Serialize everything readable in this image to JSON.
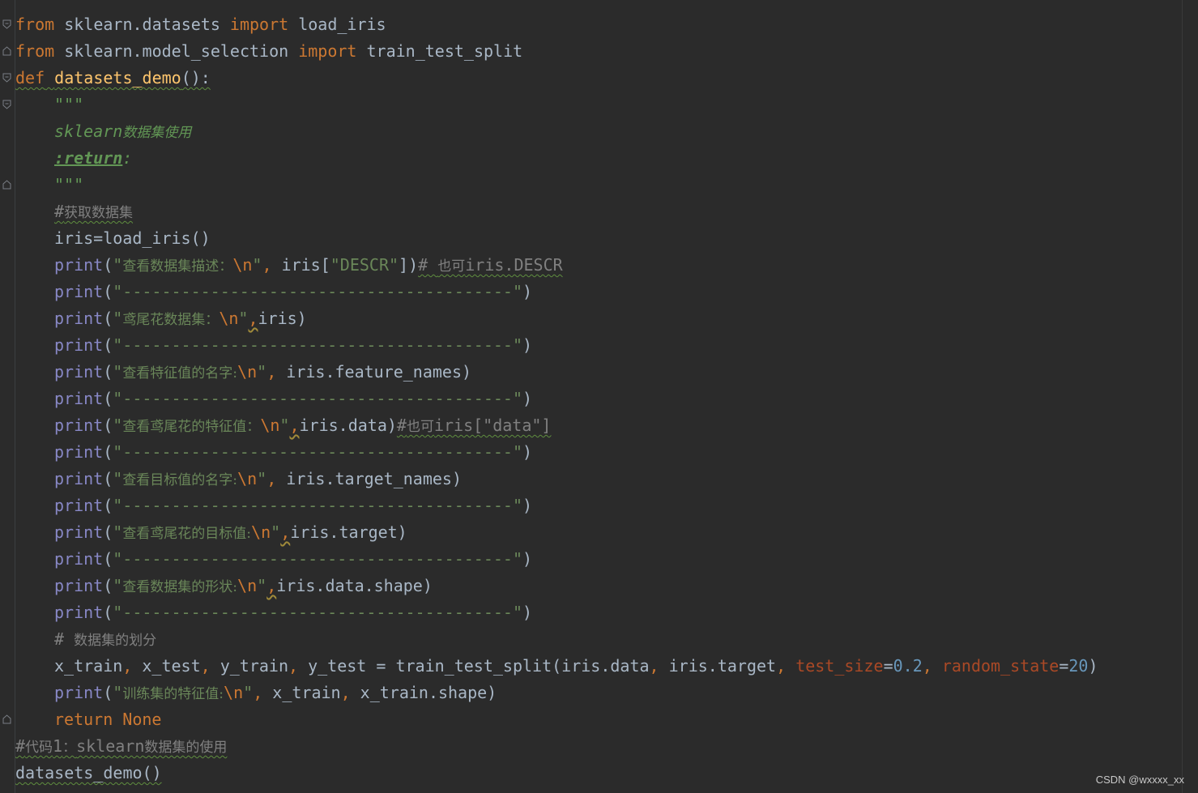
{
  "lines": [
    {
      "tokens": [
        [
          "kw",
          "from"
        ],
        [
          "plain",
          " sklearn.datasets "
        ],
        [
          "kw",
          "import"
        ],
        [
          "plain",
          " load_iris"
        ]
      ]
    },
    {
      "tokens": [
        [
          "kw",
          "from"
        ],
        [
          "plain",
          " sklearn.model_selection "
        ],
        [
          "kw",
          "import"
        ],
        [
          "plain",
          " train_test_split"
        ]
      ]
    },
    {
      "tokens": [
        [
          "kw",
          "def"
        ],
        [
          "plain",
          " "
        ],
        [
          "fn",
          "datasets_demo"
        ],
        [
          "plain",
          "():"
        ]
      ],
      "underline": true
    },
    {
      "indent": true,
      "tokens": [
        [
          "doc",
          "\"\"\""
        ]
      ]
    },
    {
      "indent": true,
      "tokens": [
        [
          "doc",
          "sklearn"
        ],
        [
          "doc cjk",
          "数据集使用"
        ]
      ]
    },
    {
      "indent": true,
      "tokens": [
        [
          "doctag",
          ":return"
        ],
        [
          "doc",
          ":"
        ]
      ]
    },
    {
      "indent": true,
      "tokens": [
        [
          "doc",
          "\"\"\""
        ]
      ]
    },
    {
      "indent": true,
      "tokens": [
        [
          "cm warn",
          "#"
        ],
        [
          "cm cjk warn",
          "获取数据集"
        ]
      ]
    },
    {
      "indent": true,
      "tokens": [
        [
          "plain",
          "iris=load_iris()"
        ]
      ]
    },
    {
      "indent": true,
      "tokens": [
        [
          "builtin",
          "print"
        ],
        [
          "plain",
          "("
        ],
        [
          "str",
          "\""
        ],
        [
          "str cjk",
          "查看数据集描述："
        ],
        [
          "esc",
          "\\n"
        ],
        [
          "str",
          "\""
        ],
        [
          "esc",
          ","
        ],
        [
          "plain",
          " iris["
        ],
        [
          "str",
          "\"DESCR\""
        ],
        [
          "plain",
          "])"
        ],
        [
          "cm warn",
          "# "
        ],
        [
          "cm cjk warn",
          "也可"
        ],
        [
          "cm warn",
          "iris.DESCR"
        ]
      ]
    },
    {
      "indent": true,
      "tokens": [
        [
          "builtin",
          "print"
        ],
        [
          "plain",
          "("
        ],
        [
          "str",
          "\"----------------------------------------\""
        ],
        [
          "plain",
          ")"
        ]
      ]
    },
    {
      "indent": true,
      "tokens": [
        [
          "builtin",
          "print"
        ],
        [
          "plain",
          "("
        ],
        [
          "str",
          "\""
        ],
        [
          "str cjk",
          "鸢尾花数据集："
        ],
        [
          "esc",
          "\\n"
        ],
        [
          "str",
          "\""
        ],
        [
          "esc weak",
          ","
        ],
        [
          "plain",
          "iris)"
        ]
      ]
    },
    {
      "indent": true,
      "tokens": [
        [
          "builtin",
          "print"
        ],
        [
          "plain",
          "("
        ],
        [
          "str",
          "\"----------------------------------------\""
        ],
        [
          "plain",
          ")"
        ]
      ]
    },
    {
      "indent": true,
      "tokens": [
        [
          "builtin",
          "print"
        ],
        [
          "plain",
          "("
        ],
        [
          "str",
          "\""
        ],
        [
          "str cjk",
          "查看特征值的名字:"
        ],
        [
          "esc",
          "\\n"
        ],
        [
          "str",
          "\""
        ],
        [
          "esc",
          ","
        ],
        [
          "plain",
          " iris.feature_names)"
        ]
      ]
    },
    {
      "indent": true,
      "tokens": [
        [
          "builtin",
          "print"
        ],
        [
          "plain",
          "("
        ],
        [
          "str",
          "\"----------------------------------------\""
        ],
        [
          "plain",
          ")"
        ]
      ]
    },
    {
      "indent": true,
      "tokens": [
        [
          "builtin",
          "print"
        ],
        [
          "plain",
          "("
        ],
        [
          "str",
          "\""
        ],
        [
          "str cjk",
          "查看鸢尾花的特征值："
        ],
        [
          "esc",
          "\\n"
        ],
        [
          "str",
          "\""
        ],
        [
          "esc weak",
          ","
        ],
        [
          "plain",
          "iris.data)"
        ],
        [
          "cm warn",
          "#"
        ],
        [
          "cm cjk warn",
          "也可"
        ],
        [
          "cm warn",
          "iris[\"data\"]"
        ]
      ]
    },
    {
      "indent": true,
      "tokens": [
        [
          "builtin",
          "print"
        ],
        [
          "plain",
          "("
        ],
        [
          "str",
          "\"----------------------------------------\""
        ],
        [
          "plain",
          ")"
        ]
      ]
    },
    {
      "indent": true,
      "tokens": [
        [
          "builtin",
          "print"
        ],
        [
          "plain",
          "("
        ],
        [
          "str",
          "\""
        ],
        [
          "str cjk",
          "查看目标值的名字:"
        ],
        [
          "esc",
          "\\n"
        ],
        [
          "str",
          "\""
        ],
        [
          "esc",
          ","
        ],
        [
          "plain",
          " iris.target_names)"
        ]
      ]
    },
    {
      "indent": true,
      "tokens": [
        [
          "builtin",
          "print"
        ],
        [
          "plain",
          "("
        ],
        [
          "str",
          "\"----------------------------------------\""
        ],
        [
          "plain",
          ")"
        ]
      ]
    },
    {
      "indent": true,
      "tokens": [
        [
          "builtin",
          "print"
        ],
        [
          "plain",
          "("
        ],
        [
          "str",
          "\""
        ],
        [
          "str cjk",
          "查看鸢尾花的目标值:"
        ],
        [
          "esc",
          "\\n"
        ],
        [
          "str",
          "\""
        ],
        [
          "esc weak",
          ","
        ],
        [
          "plain",
          "iris.target)"
        ]
      ]
    },
    {
      "indent": true,
      "tokens": [
        [
          "builtin",
          "print"
        ],
        [
          "plain",
          "("
        ],
        [
          "str",
          "\"----------------------------------------\""
        ],
        [
          "plain",
          ")"
        ]
      ]
    },
    {
      "indent": true,
      "tokens": [
        [
          "builtin",
          "print"
        ],
        [
          "plain",
          "("
        ],
        [
          "str",
          "\""
        ],
        [
          "str cjk",
          "查看数据集的形状:"
        ],
        [
          "esc",
          "\\n"
        ],
        [
          "str",
          "\""
        ],
        [
          "esc weak",
          ","
        ],
        [
          "plain",
          "iris.data.shape)"
        ]
      ]
    },
    {
      "indent": true,
      "tokens": [
        [
          "builtin",
          "print"
        ],
        [
          "plain",
          "("
        ],
        [
          "str",
          "\"----------------------------------------\""
        ],
        [
          "plain",
          ")"
        ]
      ]
    },
    {
      "indent": true,
      "tokens": [
        [
          "cm",
          "# "
        ],
        [
          "cm cjk",
          "数据集的划分"
        ]
      ]
    },
    {
      "indent": true,
      "tokens": [
        [
          "plain",
          "x_train"
        ],
        [
          "esc",
          ","
        ],
        [
          "plain",
          " x_test"
        ],
        [
          "esc",
          ","
        ],
        [
          "plain",
          " y_train"
        ],
        [
          "esc",
          ","
        ],
        [
          "plain",
          " y_test = train_test_split(iris.data"
        ],
        [
          "esc",
          ","
        ],
        [
          "plain",
          " iris.target"
        ],
        [
          "esc",
          ","
        ],
        [
          "plain",
          " "
        ],
        [
          "param",
          "test_size"
        ],
        [
          "plain",
          "="
        ],
        [
          "num",
          "0.2"
        ],
        [
          "esc",
          ","
        ],
        [
          "plain",
          " "
        ],
        [
          "param",
          "random_state"
        ],
        [
          "plain",
          "="
        ],
        [
          "num",
          "20"
        ],
        [
          "plain",
          ")"
        ]
      ]
    },
    {
      "indent": true,
      "tokens": [
        [
          "builtin",
          "print"
        ],
        [
          "plain",
          "("
        ],
        [
          "str",
          "\""
        ],
        [
          "str cjk",
          "训练集的特征值:"
        ],
        [
          "esc",
          "\\n"
        ],
        [
          "str",
          "\""
        ],
        [
          "esc",
          ","
        ],
        [
          "plain",
          " x_train"
        ],
        [
          "esc",
          ","
        ],
        [
          "plain",
          " x_train.shape)"
        ]
      ]
    },
    {
      "indent": true,
      "tokens": [
        [
          "kw",
          "return"
        ],
        [
          "plain",
          " "
        ],
        [
          "kw",
          "None"
        ]
      ]
    },
    {
      "tokens": [
        [
          "cm warn",
          "#"
        ],
        [
          "cm cjk warn",
          "代码"
        ],
        [
          "cm warn",
          "1"
        ],
        [
          "cm cjk warn",
          "："
        ],
        [
          "cm warn",
          "sklearn"
        ],
        [
          "cm cjk warn",
          "数据集的使用"
        ]
      ]
    },
    {
      "tokens": [
        [
          "plain warn",
          "datasets_demo()"
        ]
      ]
    }
  ],
  "watermark": "CSDN @wxxxx_xx",
  "colors": {
    "background": "#2b2b2b",
    "keyword": "#cc7832",
    "function": "#ffc66d",
    "string": "#6a8759",
    "comment": "#808080",
    "builtin": "#8888c6",
    "param": "#aa4926",
    "number": "#6897bb",
    "text": "#a9b7c6"
  },
  "fold_icons": [
    "fold-open-icon",
    "fold-open-icon",
    "fold-open-icon",
    "fold-open-icon",
    "fold-close-icon",
    "fold-close-icon"
  ]
}
